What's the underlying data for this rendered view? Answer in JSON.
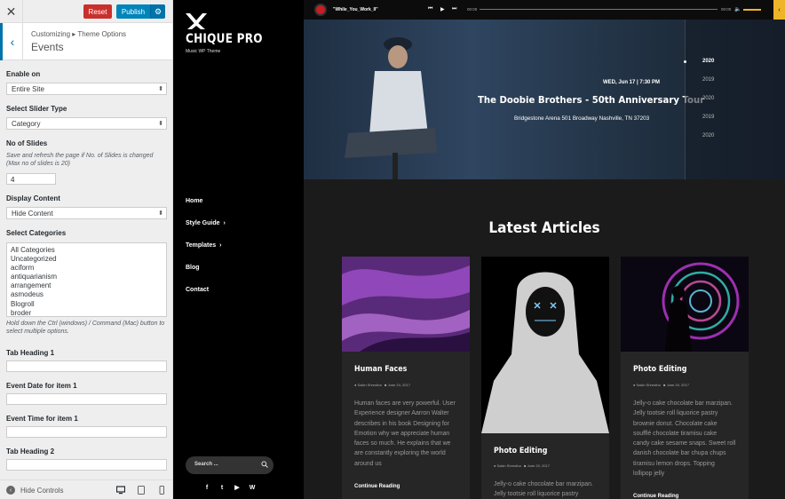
{
  "customizer": {
    "close_label": "✕",
    "reset_label": "Reset",
    "publish_label": "Publish",
    "breadcrumb": "Customizing ▸ Theme Options",
    "section_title": "Events",
    "enable_on": {
      "label": "Enable on",
      "value": "Entire Site"
    },
    "slider_type": {
      "label": "Select Slider Type",
      "value": "Category"
    },
    "no_of_slides": {
      "label": "No of Slides",
      "description": "Save and refresh the page if No. of Slides is changed (Max no of slides is 20)",
      "value": "4"
    },
    "display_content": {
      "label": "Display Content",
      "value": "Hide Content"
    },
    "select_categories": {
      "label": "Select Categories",
      "options": [
        "All Categories",
        "Uncategorized",
        "aciform",
        "antiquarianism",
        "arrangement",
        "asmodeus",
        "Blogroll",
        "broder"
      ],
      "description": "Hold down the Ctrl (windows) / Command (Mac) button to select multiple options."
    },
    "tab_heading_1": {
      "label": "Tab Heading 1",
      "value": ""
    },
    "event_date_1": {
      "label": "Event Date for item 1",
      "value": ""
    },
    "event_time_1": {
      "label": "Event Time for item 1",
      "value": ""
    },
    "tab_heading_2": {
      "label": "Tab Heading 2",
      "value": ""
    },
    "hide_controls_label": "Hide Controls",
    "devices": [
      "desktop-icon",
      "tablet-icon",
      "mobile-icon"
    ]
  },
  "site": {
    "logo_title": "CHIQUE PRO",
    "logo_tagline": "Music WP Theme",
    "nav": [
      {
        "label": "Home",
        "has_children": false
      },
      {
        "label": "Style Guide",
        "has_children": true
      },
      {
        "label": "Templates",
        "has_children": true
      },
      {
        "label": "Blog",
        "has_children": false
      },
      {
        "label": "Contact",
        "has_children": false
      }
    ],
    "search_placeholder": "Search ...",
    "social": [
      "facebook-icon",
      "twitter-icon",
      "youtube-icon",
      "wordpress-icon"
    ]
  },
  "player": {
    "track": "\"While_You_Work_II\"",
    "current_time": "00:00",
    "duration": "00:00",
    "accent_color": "#f0b429"
  },
  "hero": {
    "date": "WED, Jun 17   |   7:30 PM",
    "title": "The Doobie Brothers - 50th Anniversary Tour",
    "venue": "Bridgestone Arena 501 Broadway Nashville, TN 37203",
    "years": [
      "2020",
      "2019",
      "2020",
      "2019",
      "2020"
    ],
    "active_year_index": 0
  },
  "articles": {
    "heading": "Latest Articles",
    "cards": [
      {
        "title": "Human Faces",
        "author": "Sakin Shrestha",
        "date": "June 24, 2017",
        "body_lines": [
          "Human faces are very powerful. User",
          "Experience designer Aarron Walter",
          "describes in his book Designing for",
          "Emotion why we appreciate human",
          "faces so much. He explains that we",
          "are constantly exploring the world",
          "around us"
        ],
        "more": "Continue Reading"
      },
      {
        "title": "Photo Editing",
        "author": "Sakin Shrestha",
        "date": "June 20, 2017",
        "body_lines": [
          "Jelly-o cake chocolate bar marzipan.",
          "Jelly tootsie roll liquorice pastry"
        ],
        "more": ""
      },
      {
        "title": "Photo Editing",
        "author": "Sakin Shrestha",
        "date": "June 20, 2017",
        "body_lines": [
          "Jelly-o cake chocolate bar marzipan.",
          "Jelly tootsie roll liquorice pastry",
          "brownie donut. Chocolate cake",
          "soufflé chocolate tiramisu cake",
          "candy cake sesame snaps. Sweet roll",
          "danish chocolate bar chupa chups",
          "tiramisu lemon drops. Topping",
          "lollipop jelly"
        ],
        "more": "Continue Reading"
      }
    ]
  }
}
